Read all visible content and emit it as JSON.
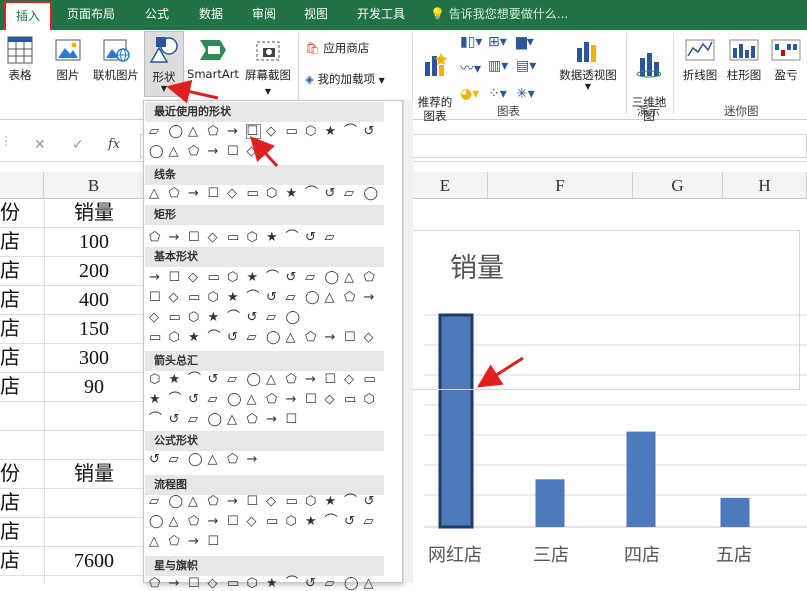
{
  "tabs": [
    "插入",
    "页面布局",
    "公式",
    "数据",
    "审阅",
    "视图",
    "开发工具"
  ],
  "tell_me": "告诉我您想要做什么...",
  "ribbon": {
    "table": "表格",
    "picture": "图片",
    "online_picture": "联机图片",
    "shapes": "形状",
    "smartart": "SmartArt",
    "screenshot": "屏幕截图",
    "app_store": "应用商店",
    "my_addins": "我的加载项",
    "recommended_charts": "推荐的\n图表",
    "pivot_chart": "数据透视图",
    "map3d": "三维地\n图",
    "line_spark": "折线图",
    "column_spark": "柱形图",
    "winloss_spark": "盈亏",
    "group_charts": "图表",
    "group_demo": "演示",
    "group_spark": "迷你图"
  },
  "formula_bar": {
    "cancel": "✕",
    "enter": "✓",
    "fx": "fx"
  },
  "columns": [
    "B",
    "E",
    "F",
    "G",
    "H"
  ],
  "rows_left": [
    "份",
    "店",
    "店",
    "店",
    "店",
    "店",
    "店",
    "",
    "",
    "份",
    "店",
    "店",
    "店"
  ],
  "rows_right": [
    "销量",
    "100",
    "200",
    "400",
    "150",
    "300",
    "90",
    "",
    "",
    "销量",
    "",
    "",
    "7600"
  ],
  "shapes_menu": {
    "sections": [
      "最近使用的形状",
      "线条",
      "矩形",
      "基本形状",
      "箭头总汇",
      "公式形状",
      "流程图",
      "星与旗帜"
    ]
  },
  "chart": {
    "title": "销量",
    "categories": [
      "网红店",
      "三店",
      "四店",
      "五店"
    ]
  },
  "chart_data": {
    "type": "bar",
    "title": "销量",
    "categories": [
      "网红店",
      "三店",
      "四店",
      "五店"
    ],
    "values": [
      400,
      90,
      180,
      55
    ],
    "highlighted": "网红店"
  },
  "colors": {
    "excel_green": "#217346",
    "bar": "#4e79bd",
    "highlight": "#e02020"
  }
}
